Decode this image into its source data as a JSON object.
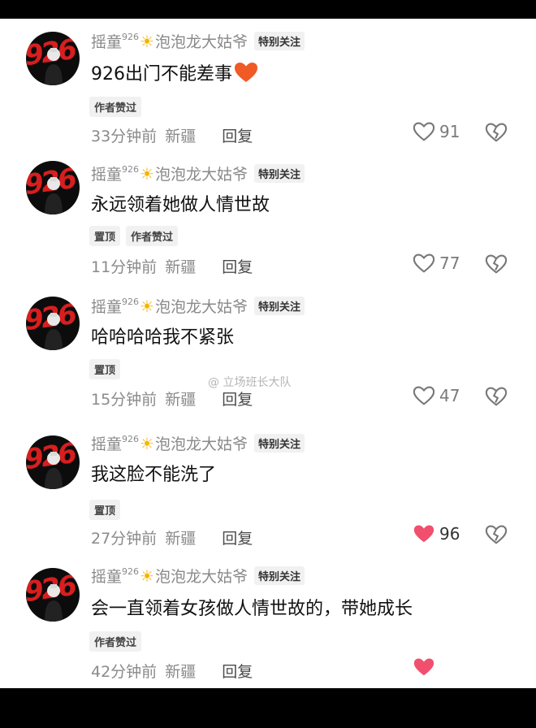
{
  "comments": [
    {
      "username": "摇童",
      "sup": "926",
      "sun": "☀",
      "suffix": "泡泡龙大姑爷",
      "follow_tag": "特别关注",
      "text": "926出门不能差事",
      "emoji": "heart",
      "tags": [
        "作者赞过"
      ],
      "time": "33分钟前",
      "region": "新疆",
      "reply": "回复",
      "likes": "91",
      "liked": false
    },
    {
      "username": "摇童",
      "sup": "926",
      "sun": "☀",
      "suffix": "泡泡龙大姑爷",
      "follow_tag": "特别关注",
      "text": "永远领着她做人情世故",
      "tags": [
        "置顶",
        "作者赞过"
      ],
      "time": "11分钟前",
      "region": "新疆",
      "reply": "回复",
      "likes": "77",
      "liked": false
    },
    {
      "username": "摇童",
      "sup": "926",
      "sun": "☀",
      "suffix": "泡泡龙大姑爷",
      "follow_tag": "特别关注",
      "text": "哈哈哈哈我不紧张",
      "tags": [
        "置顶"
      ],
      "time": "15分钟前",
      "region": "新疆",
      "reply": "回复",
      "likes": "47",
      "liked": false
    },
    {
      "username": "摇童",
      "sup": "926",
      "sun": "☀",
      "suffix": "泡泡龙大姑爷",
      "follow_tag": "特别关注",
      "text": "我这脸不能洗了",
      "tags": [
        "置顶"
      ],
      "time": "27分钟前",
      "region": "新疆",
      "reply": "回复",
      "likes": "96",
      "liked": true
    },
    {
      "username": "摇童",
      "sup": "926",
      "sun": "☀",
      "suffix": "泡泡龙大姑爷",
      "follow_tag": "特别关注",
      "text": "会一直领着女孩做人情世故的，带她成长",
      "tags": [
        "作者赞过"
      ],
      "time": "42分钟前",
      "region": "新疆",
      "reply": "回复",
      "likes": "",
      "liked": true
    }
  ],
  "avatar_text": "926",
  "watermark": "立场班长大队",
  "colors": {
    "like_red": "#f0506e",
    "avatar_red": "#d81e1e",
    "sun": "#f7b500"
  }
}
